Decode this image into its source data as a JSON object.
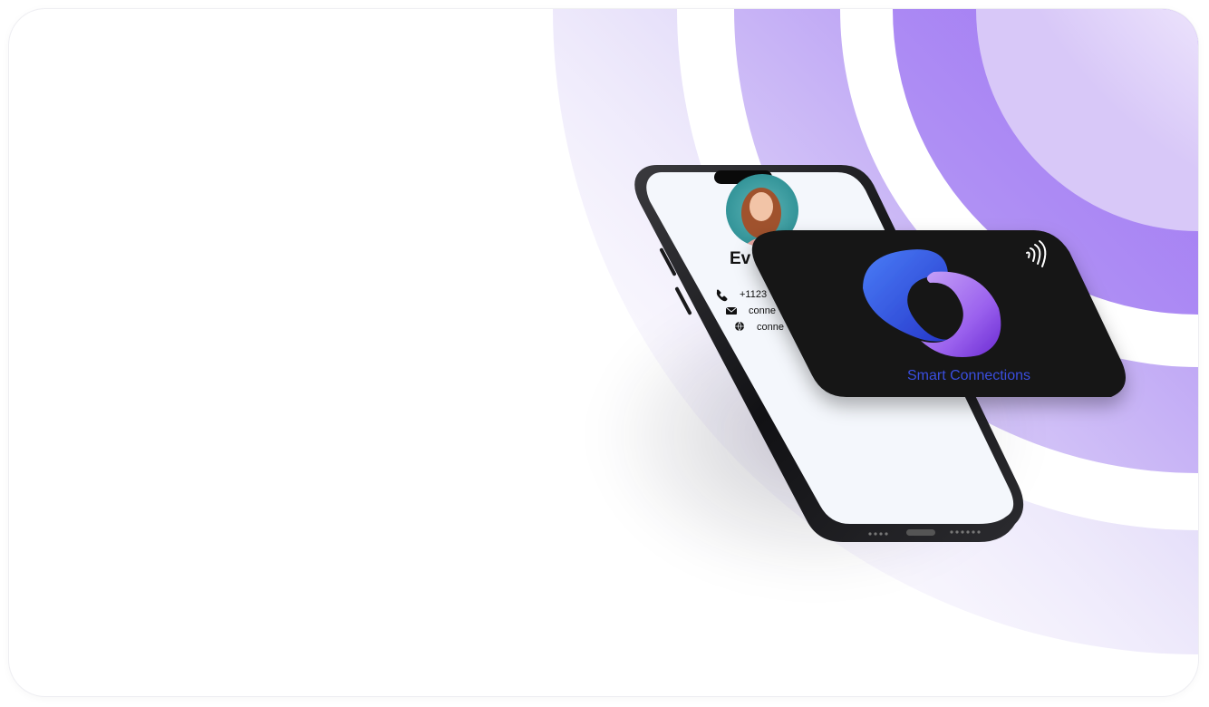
{
  "hero": {
    "contact": {
      "name": "Ev",
      "phone": "+1123",
      "email": "conne",
      "website": "conne"
    },
    "card": {
      "brand_label": "Smart Connections",
      "nfc_icon": "nfc-wave-icon"
    }
  },
  "colors": {
    "accent": "#8b4cf5",
    "accent_light": "#c9b8f6",
    "card_bg": "#121212",
    "brand_text": "#3b4fe0",
    "phone_screen": "#f4f7fc"
  }
}
